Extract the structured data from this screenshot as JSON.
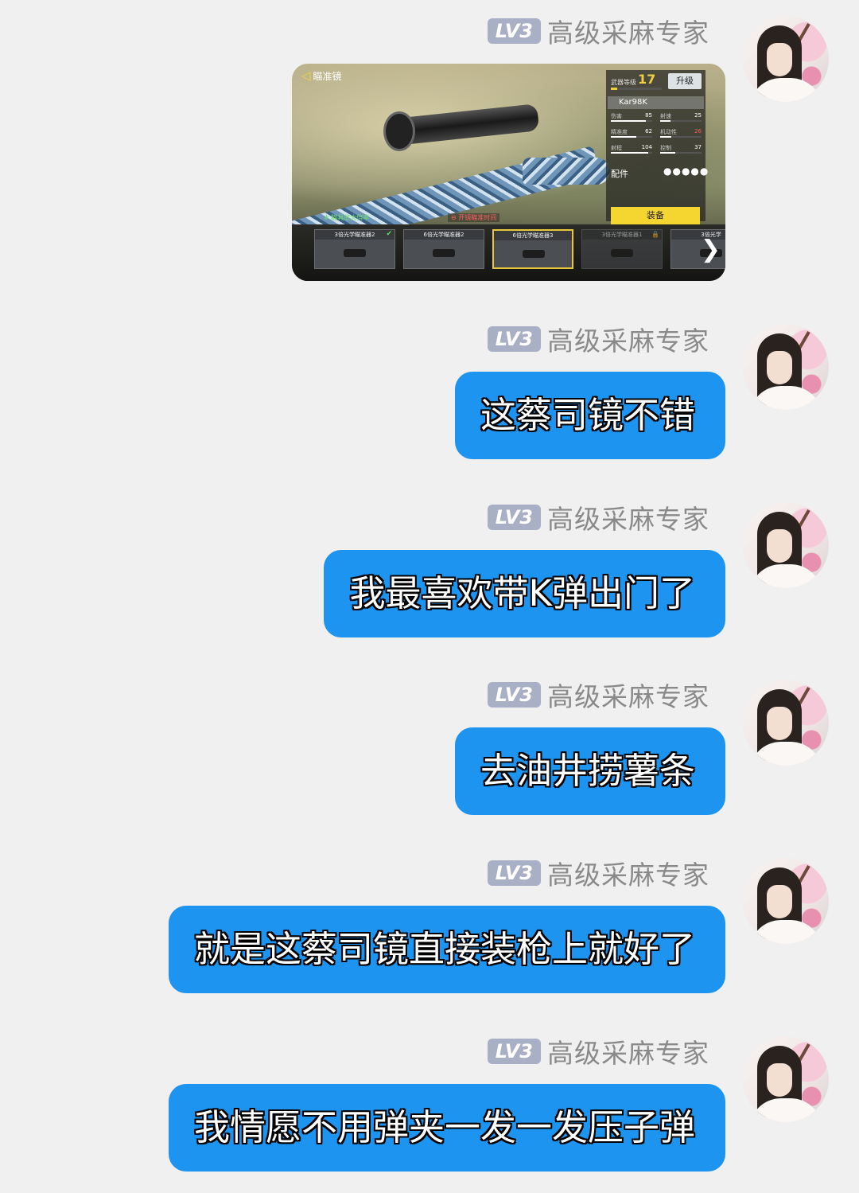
{
  "user": {
    "level_badge": "LV3",
    "name": "高级采麻专家"
  },
  "game_shot": {
    "title": "瞄准镜",
    "weapon_level_label": "武器等级",
    "weapon_level": "17",
    "upgrade_button": "升级",
    "weapon_level_progress": 0.12,
    "gun_name": "Kar98K",
    "stats": [
      {
        "label": "伤害",
        "value": "85",
        "fill": 0.85,
        "highlight": false
      },
      {
        "label": "射速",
        "value": "25",
        "fill": 0.25,
        "highlight": false
      },
      {
        "label": "精准度",
        "value": "62",
        "fill": 0.62,
        "highlight": false
      },
      {
        "label": "机动性",
        "value": "26",
        "fill": 0.26,
        "highlight": true
      },
      {
        "label": "射程",
        "value": "104",
        "fill": 0.9,
        "highlight": false
      },
      {
        "label": "控制",
        "value": "37",
        "fill": 0.37,
        "highlight": false
      }
    ],
    "attachments_label": "配件",
    "attachments_dots": "●●●●●",
    "equip_button": "装备",
    "hint_positive": "✲ 瞄具放大倍率",
    "hint_negative": "⊖ 开镜瞄准时间",
    "scopes": [
      {
        "label": "3倍光学瞄准器2",
        "equipped": true,
        "locked": false,
        "selected": false
      },
      {
        "label": "6倍光学瞄准器2",
        "equipped": false,
        "locked": false,
        "selected": false
      },
      {
        "label": "6倍光学瞄准器3",
        "equipped": false,
        "locked": false,
        "selected": true
      },
      {
        "label": "3倍光学瞄准器1",
        "equipped": false,
        "locked": true,
        "selected": false
      },
      {
        "label": "3倍光学",
        "equipped": false,
        "locked": false,
        "selected": false
      }
    ],
    "check_glyph": "✔",
    "lock_glyph": "🔒",
    "next_glyph": "❯"
  },
  "messages": [
    {
      "text": "这蔡司镜不错"
    },
    {
      "text": "我最喜欢带K弹出门了"
    },
    {
      "text": "去油井捞薯条"
    },
    {
      "text": "就是这蔡司镜直接装枪上就好了"
    },
    {
      "text": "我情愿不用弹夹一发一发压子弹"
    }
  ],
  "colors": {
    "bubble": "#1c94f0",
    "background": "#f0f0f0",
    "badge": "#a9afc4"
  }
}
